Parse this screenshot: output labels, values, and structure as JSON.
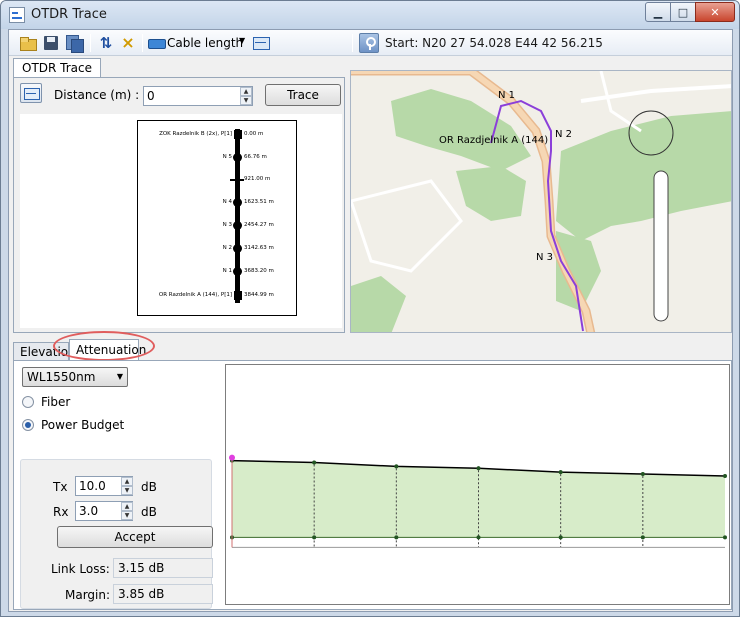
{
  "window": {
    "title": "OTDR  Trace"
  },
  "toolbar": {
    "cable_label": "Cable length",
    "start_coords": "Start: N20 27 54.028 E44 42 56.215"
  },
  "trace_tab": {
    "label": "OTDR Trace"
  },
  "distance": {
    "label": "Distance (m) :",
    "value": "0"
  },
  "trace_button": "Trace",
  "trace_nodes": [
    {
      "label": "ZOK Razdelnik B (2x), P[1]",
      "value": "0.00 m",
      "shape": "square"
    },
    {
      "label": "N 5",
      "value": "66.76 m",
      "shape": "dot"
    },
    {
      "label": "",
      "value": "921.00 m",
      "shape": "bar"
    },
    {
      "label": "N 4",
      "value": "1623.51 m",
      "shape": "dot"
    },
    {
      "label": "N 3",
      "value": "2454.27 m",
      "shape": "dot"
    },
    {
      "label": "N 2",
      "value": "3142.63 m",
      "shape": "dot"
    },
    {
      "label": "N 1",
      "value": "3683.20 m",
      "shape": "dot"
    },
    {
      "label": "OR Razdelnik A (144), P[1]",
      "value": "3844.99 m",
      "shape": "square"
    }
  ],
  "map": {
    "labels": [
      "N 1",
      "N 2",
      "N 3",
      "OR Razdjelnik A (144)"
    ],
    "route_color": "#8b3fd9"
  },
  "bottom_tabs": [
    "Elevation",
    "Attenuation"
  ],
  "wavelength": {
    "selected": "WL1550nm"
  },
  "mode": {
    "fiber": "Fiber",
    "power_budget": "Power Budget",
    "selected": "power_budget"
  },
  "budget": {
    "tx_label": "Tx",
    "tx_value": "10.0",
    "tx_unit": "dB",
    "rx_label": "Rx",
    "rx_value": "3.0",
    "rx_unit": "dB",
    "accept": "Accept",
    "link_loss_label": "Link Loss:",
    "link_loss_value": "3.15 dB",
    "margin_label": "Margin:",
    "margin_value": "3.85 dB"
  },
  "chart_data": {
    "type": "line",
    "title": "",
    "xlabel": "",
    "ylabel": "",
    "x": [
      0,
      1,
      2,
      3,
      4,
      5,
      6
    ],
    "series": [
      {
        "values": [
          7.0,
          6.9,
          6.7,
          6.6,
          6.4,
          6.3,
          6.2
        ]
      },
      {
        "values": [
          3.0,
          3.0,
          3.0,
          3.0,
          3.0,
          3.0,
          3.0
        ]
      }
    ],
    "band_color": "#d7ecc9",
    "start_marker_color": "#e040e0"
  }
}
